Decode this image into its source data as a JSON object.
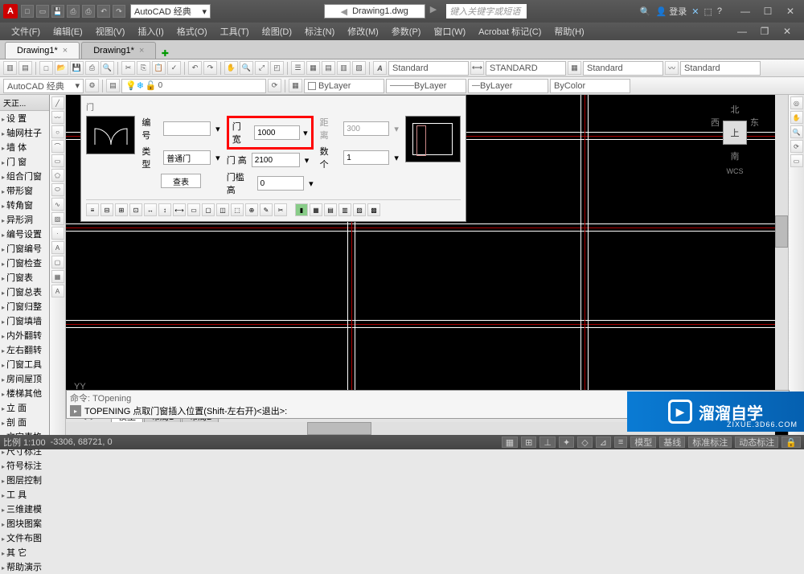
{
  "titlebar": {
    "logo": "A",
    "workspace": "AutoCAD 经典",
    "filename": "Drawing1.dwg",
    "search_placeholder": "键入关键字或短语",
    "login": "登录",
    "help_dd": "▾"
  },
  "menubar": [
    "文件(F)",
    "编辑(E)",
    "视图(V)",
    "插入(I)",
    "格式(O)",
    "工具(T)",
    "绘图(D)",
    "标注(N)",
    "修改(M)",
    "参数(P)",
    "窗口(W)",
    "Acrobat 标记(C)",
    "帮助(H)"
  ],
  "doc_tabs": [
    {
      "label": "Drawing1*",
      "active": true
    },
    {
      "label": "Drawing1*",
      "active": false
    }
  ],
  "toolbar2": {
    "styles": [
      "Standard",
      "STANDARD",
      "Standard",
      "Standard"
    ]
  },
  "toolbar3": {
    "workspace": "AutoCAD 经典",
    "layer_color": "ByLayer",
    "linetype": "ByLayer",
    "lineweight": "ByLayer",
    "bycolor": "ByColor"
  },
  "left_panel": {
    "title": "天正...",
    "items": [
      "设   置",
      "轴网柱子",
      "墙   体",
      "门   窗",
      "组合门窗",
      "带形窗",
      "转角窗",
      "异形洞",
      "编号设置",
      "门窗编号",
      "门窗检查",
      "门窗表",
      "门窗总表",
      "门窗归整",
      "门窗填墙",
      "内外翻转",
      "左右翻转",
      "门窗工具",
      "房间屋顶",
      "楼梯其他",
      "立   面",
      "剖   面",
      "文字表格",
      "尺寸标注",
      "符号标注",
      "图层控制",
      "工   具",
      "三维建模",
      "图块图案",
      "文件布图",
      "其   它",
      "帮助演示"
    ]
  },
  "popup": {
    "title": "门",
    "number_label": "编号",
    "number_value": "",
    "type_label": "类型",
    "type_value": "普通门",
    "lookup_btn": "查表",
    "width_label": "门 宽",
    "width_value": "1000",
    "height_label": "门 高",
    "height_value": "2100",
    "sill_label": "门槛高",
    "sill_value": "0",
    "dist_label": "距 离",
    "dist_value": "300",
    "count_label": "数 个",
    "count_value": "1"
  },
  "viewcube": {
    "n": "北",
    "s": "南",
    "e": "东",
    "w": "西",
    "top": "上",
    "wcs": "WCS"
  },
  "model_tabs": [
    "模型",
    "布局1",
    "布局2"
  ],
  "cmdline": {
    "prev": "命令: TOpening",
    "current": "TOPENING 点取门窗插入位置(Shift-左右开)<退出>:"
  },
  "statusbar": {
    "scale": "比例 1:100",
    "coords": "-3306, 68721, 0",
    "right_items": [
      "模型",
      "基线",
      "标准标注",
      "动态标注"
    ]
  },
  "watermark": {
    "text": "溜溜自学",
    "url": "ZIXUE.3D66.COM"
  }
}
